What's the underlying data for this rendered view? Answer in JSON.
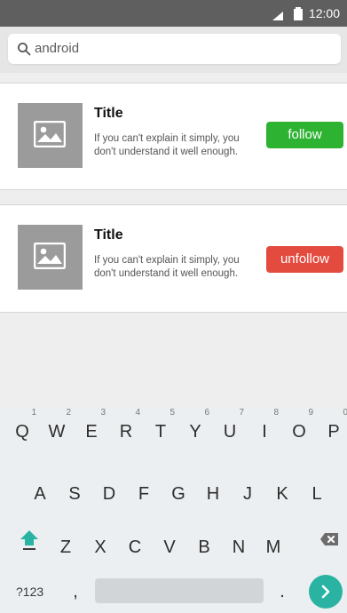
{
  "status_bar": {
    "time": "12:00"
  },
  "search": {
    "value": "android"
  },
  "cards": [
    {
      "title": "Title",
      "description": "If you can't explain it simply, you don't understand it well enough.",
      "button_label": "follow",
      "button_color": "#2db232"
    },
    {
      "title": "Title",
      "description": "If you can't explain it simply, you don't understand it well enough.",
      "button_label": "unfollow",
      "button_color": "#e44b3f"
    }
  ],
  "keyboard": {
    "rows": [
      [
        {
          "label": "Q",
          "hint": "1"
        },
        {
          "label": "W",
          "hint": "2"
        },
        {
          "label": "E",
          "hint": "3"
        },
        {
          "label": "R",
          "hint": "4"
        },
        {
          "label": "T",
          "hint": "5"
        },
        {
          "label": "Y",
          "hint": "6"
        },
        {
          "label": "U",
          "hint": "7"
        },
        {
          "label": "I",
          "hint": "8"
        },
        {
          "label": "O",
          "hint": "9"
        },
        {
          "label": "P",
          "hint": "0"
        }
      ],
      [
        {
          "label": "A"
        },
        {
          "label": "S"
        },
        {
          "label": "D"
        },
        {
          "label": "F"
        },
        {
          "label": "G"
        },
        {
          "label": "H"
        },
        {
          "label": "J"
        },
        {
          "label": "K"
        },
        {
          "label": "L"
        }
      ],
      [
        {
          "label": "Z"
        },
        {
          "label": "X"
        },
        {
          "label": "C"
        },
        {
          "label": "V"
        },
        {
          "label": "B"
        },
        {
          "label": "N"
        },
        {
          "label": "M"
        }
      ]
    ],
    "symbols_label": "?123",
    "comma_label": ",",
    "period_label": ".",
    "accent_color": "#2ab3a2"
  }
}
